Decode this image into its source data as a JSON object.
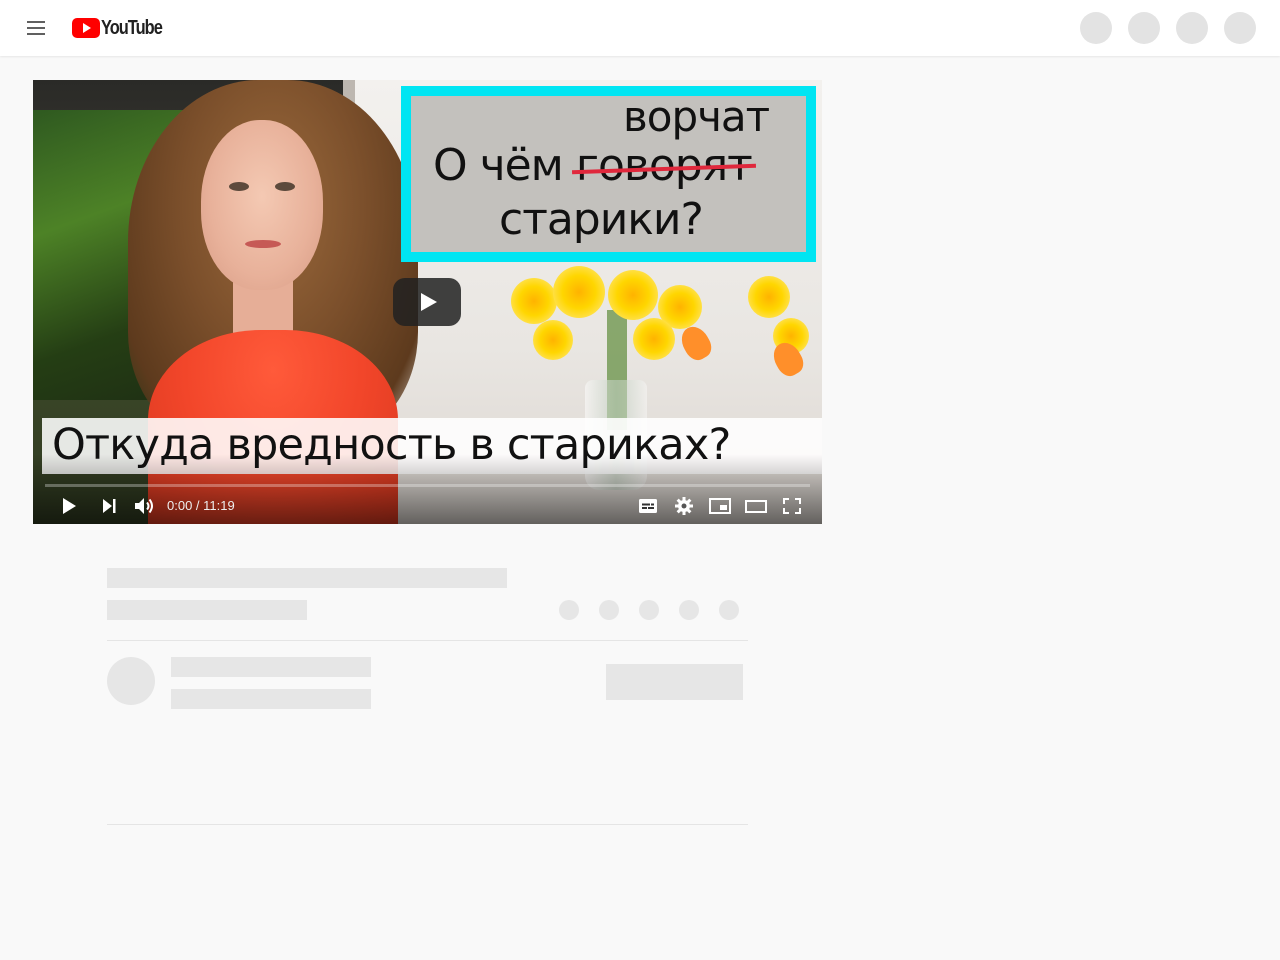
{
  "header": {
    "logo_text": "YouTube",
    "menu_icon": "hamburger-menu-icon",
    "right_placeholders": 4
  },
  "video": {
    "thumbnail": {
      "caption_top_word": "ворчат",
      "caption_line2_prefix": "О чём",
      "caption_line2_struck": "говорят",
      "caption_line3": "старики?",
      "bottom_caption": "Откуда вредность в стариках?"
    },
    "controls": {
      "current_time": "0:00",
      "duration": "11:19",
      "time_display": "0:00 / 11:19",
      "progress_fraction": 0.0,
      "icons": [
        "play-icon",
        "next-icon",
        "volume-icon",
        "subtitles-icon",
        "settings-icon",
        "miniplayer-icon",
        "theater-icon",
        "fullscreen-icon"
      ]
    },
    "accent_color": "#ff0000"
  },
  "placeholders": {
    "action_circles": 5
  }
}
